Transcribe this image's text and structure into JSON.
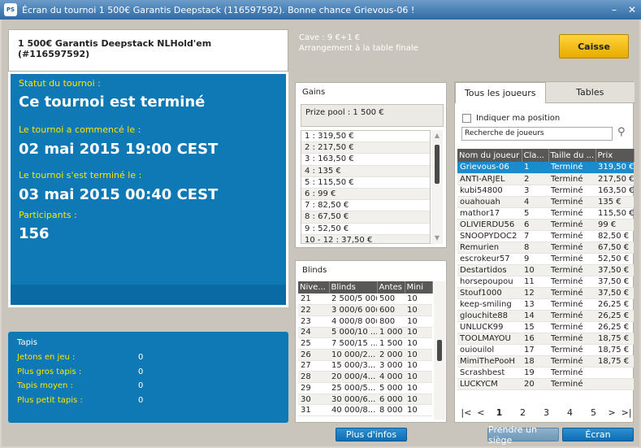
{
  "window": {
    "title": "Écran du tournoi 1 500€ Garantis Deepstack (116597592). Bonne chance Grievous-06 !",
    "logo": "PS",
    "minimize": "–",
    "close": "✕"
  },
  "tournament": {
    "name": "1 500€ Garantis Deepstack NLHold'em (#116597592)"
  },
  "status": {
    "status_label": "Statut du tournoi :",
    "status_value": "Ce tournoi est terminé",
    "started_label": "Le tournoi a commencé le :",
    "started_value": "02 mai 2015   19:00 CEST",
    "ended_label": "Le tournoi s'est terminé le :",
    "ended_value": "03 mai 2015   00:40 CEST",
    "participants_label": "Participants :",
    "participants_value": "156"
  },
  "tapis": {
    "title": "Tapis",
    "rows": [
      {
        "label": "Jetons en jeu :",
        "value": "0"
      },
      {
        "label": "Plus gros tapis :",
        "value": "0"
      },
      {
        "label": "Tapis moyen :",
        "value": "0"
      },
      {
        "label": "Plus petit tapis :",
        "value": "0"
      }
    ]
  },
  "info": {
    "cave": "Cave : 9 €+1 €",
    "arrangement": "Arrangement à la table finale"
  },
  "caisse_label": "Caisse",
  "gains": {
    "title": "Gains",
    "prize_pool": "Prize pool : 1 500 €",
    "items": [
      "1 : 319,50 €",
      "2 : 217,50 €",
      "3 : 163,50 €",
      "4 : 135 €",
      "5 : 115,50 €",
      "6 : 99 €",
      "7 : 82,50 €",
      "8 : 67,50 €",
      "9 : 52,50 €",
      "10 - 12 : 37,50 €"
    ]
  },
  "blinds": {
    "title": "Blinds",
    "headers": [
      "Nive...",
      "Blinds",
      "Antes",
      "Mini"
    ],
    "rows": [
      [
        "21",
        "2 500/5 00(",
        "500",
        "10"
      ],
      [
        "22",
        "3 000/6 00(",
        "600",
        "10"
      ],
      [
        "23",
        "4 000/8 00(",
        "800",
        "10"
      ],
      [
        "24",
        "5 000/10 ...",
        "1 000",
        "10"
      ],
      [
        "25",
        "7 500/15 ...",
        "1 500",
        "10"
      ],
      [
        "26",
        "10 000/2...",
        "2 000",
        "10"
      ],
      [
        "27",
        "15 000/3...",
        "3 000",
        "10"
      ],
      [
        "28",
        "20 000/4...",
        "4 000",
        "10"
      ],
      [
        "29",
        "25 000/5...",
        "5 000",
        "10"
      ],
      [
        "30",
        "30 000/6...",
        "6 000",
        "10"
      ],
      [
        "31",
        "40 000/8...",
        "8 000",
        "10"
      ]
    ]
  },
  "players": {
    "tabs": [
      "Tous les joueurs",
      "Tables"
    ],
    "show_position": "Indiquer ma position",
    "search_placeholder": "Recherche de joueurs",
    "headers": [
      "Nom du joueur",
      "Cla...",
      "Taille du ...",
      "Prix"
    ],
    "rows": [
      [
        "Grievous-06",
        "1",
        "Terminé",
        "319,50 €"
      ],
      [
        "ANTI-ARJEL",
        "2",
        "Terminé",
        "217,50 €"
      ],
      [
        "kubi54800",
        "3",
        "Terminé",
        "163,50 €"
      ],
      [
        "ouahouah",
        "4",
        "Terminé",
        "135 €"
      ],
      [
        "mathor17",
        "5",
        "Terminé",
        "115,50 €"
      ],
      [
        "OLIVIERDU56",
        "6",
        "Terminé",
        "99 €"
      ],
      [
        "SNOOPYDOC2",
        "7",
        "Terminé",
        "82,50 €"
      ],
      [
        "Remurien",
        "8",
        "Terminé",
        "67,50 €"
      ],
      [
        "escrokeur57",
        "9",
        "Terminé",
        "52,50 €"
      ],
      [
        "Destartidos",
        "10",
        "Terminé",
        "37,50 €"
      ],
      [
        "horsepoupou",
        "11",
        "Terminé",
        "37,50 €"
      ],
      [
        "Stouf1000",
        "12",
        "Terminé",
        "37,50 €"
      ],
      [
        "keep-smiling",
        "13",
        "Terminé",
        "26,25 €"
      ],
      [
        "glouchite88",
        "14",
        "Terminé",
        "26,25 €"
      ],
      [
        "UNLUCK99",
        "15",
        "Terminé",
        "26,25 €"
      ],
      [
        "TOOLMAYOU",
        "16",
        "Terminé",
        "18,75 €"
      ],
      [
        "ouiouilol",
        "17",
        "Terminé",
        "18,75 €"
      ],
      [
        "MimiThePooH",
        "18",
        "Terminé",
        "18,75 €"
      ],
      [
        "Scrashbest",
        "19",
        "Terminé",
        ""
      ],
      [
        "LUCKYCM",
        "20",
        "Terminé",
        ""
      ]
    ],
    "pages": [
      "1",
      "2",
      "3",
      "4",
      "5"
    ],
    "first": "|<",
    "prev": "<",
    "next": ">",
    "last": ">|"
  },
  "buttons": {
    "more_info": "Plus d'infos",
    "take_seat": "Prendre un siège",
    "screen": "Écran"
  }
}
